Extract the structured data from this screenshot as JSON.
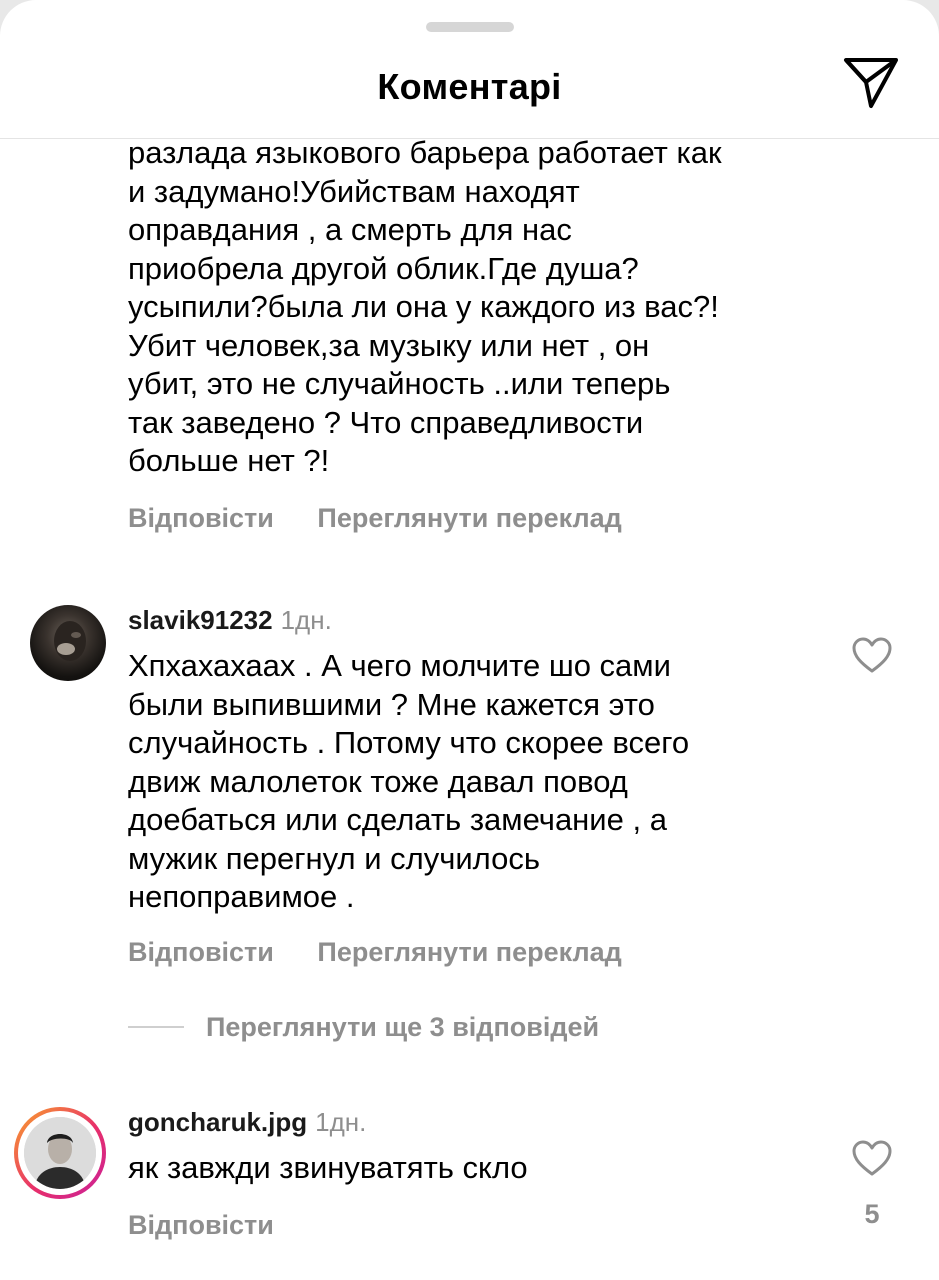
{
  "header": {
    "title": "Коментарі",
    "share_icon": "paper-plane-icon"
  },
  "comments": [
    {
      "text": "разлада языкового барьера работает как\nи задумано!Убийствам находят\nоправдания , а смерть для нас\nприобрела другой облик.Где душа?\nусыпили?была ли она у каждого из вас?!\nУбит человек,за музыку или нет , он\nубит, это не случайность ..или теперь\nтак заведено ? Что справедливости\nбольше нет ?!",
      "reply_label": "Відповісти",
      "translate_label": "Переглянути переклад"
    },
    {
      "username": "slavik91232",
      "time": "1дн.",
      "text": "Хпхахахаах . А чего молчите шо сами\nбыли выпившими ? Мне кажется это\nслучайность . Потому что скорее всего\nдвиж малолеток тоже давал повод\nдоебаться или сделать замечание , а\nмужик перегнул и случилось\nнепоправимое .",
      "reply_label": "Відповісти",
      "translate_label": "Переглянути переклад",
      "view_replies_label": "Переглянути ще 3 відповідей"
    },
    {
      "username": "goncharuk.jpg",
      "time": "1дн.",
      "text": "як завжди звинуватять скло",
      "reply_label": "Відповісти",
      "like_count": "5"
    }
  ],
  "colors": {
    "secondary_text": "#8e8e8e",
    "story_ring_start": "#f9a32a",
    "story_ring_end": "#c8209a"
  }
}
